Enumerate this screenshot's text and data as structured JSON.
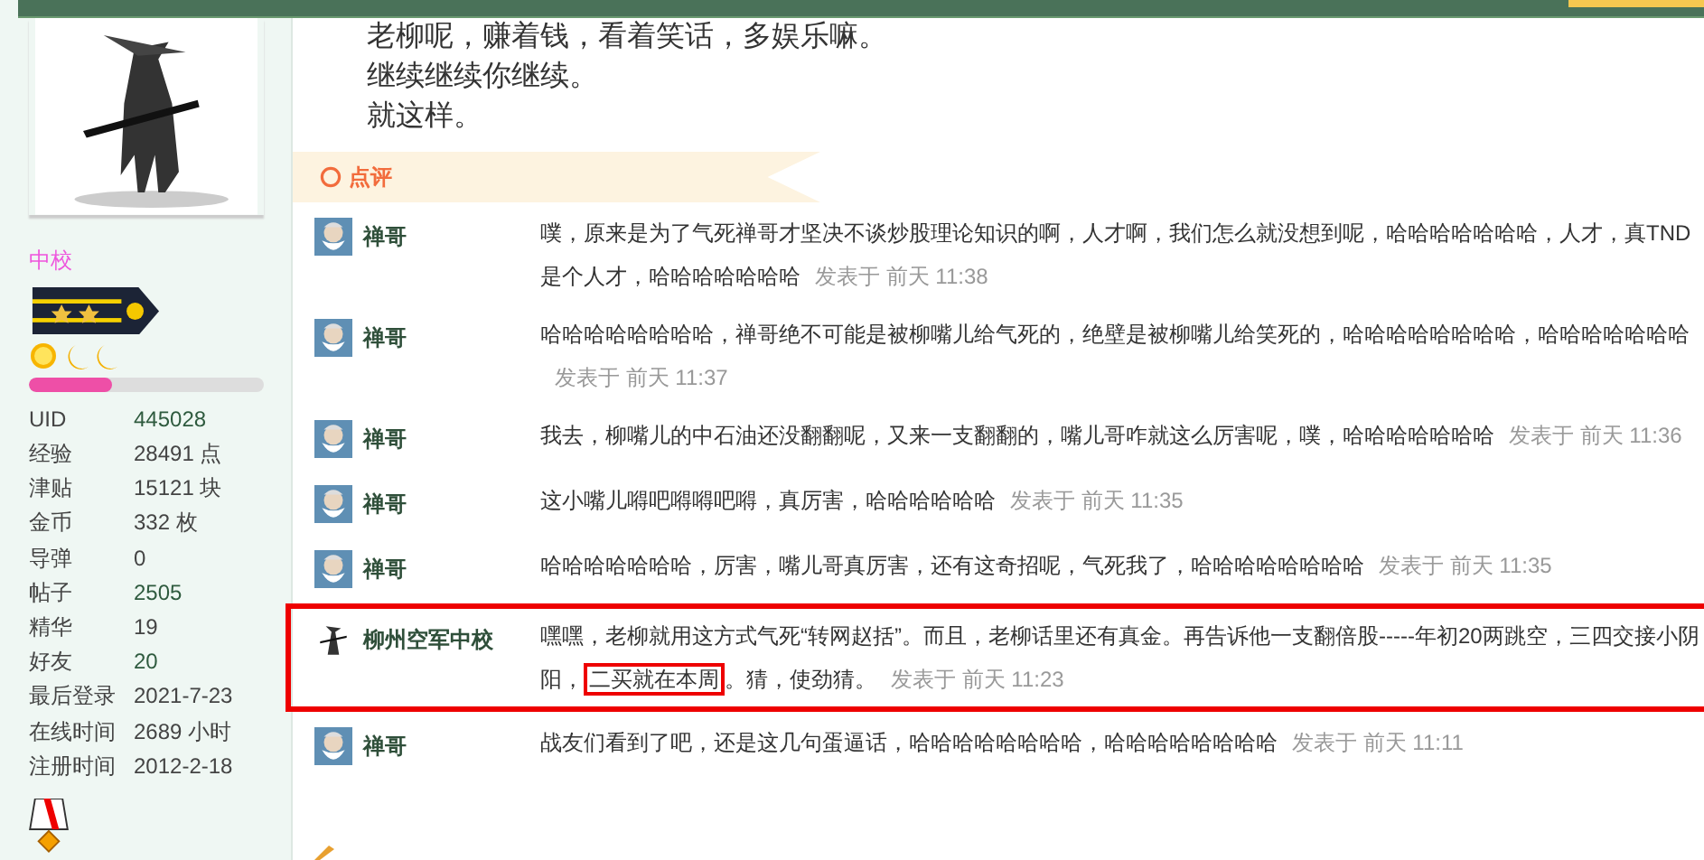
{
  "post_lines": [
    "老柳呢，赚着钱，看着笑话，多娱乐嘛。",
    "继续继续你继续。",
    "就这样。"
  ],
  "profile": {
    "rank": "中校",
    "level": 0.35,
    "stats": [
      {
        "label": "UID",
        "value": "445028",
        "link": true
      },
      {
        "label": "经验",
        "value": "28491 点",
        "link": false
      },
      {
        "label": "津贴",
        "value": "15121 块",
        "link": false
      },
      {
        "label": "金币",
        "value": "332 枚",
        "link": false
      },
      {
        "label": "导弹",
        "value": "0",
        "link": false
      },
      {
        "label": "帖子",
        "value": "2505",
        "link": true
      },
      {
        "label": "精华",
        "value": "19",
        "link": false
      },
      {
        "label": "好友",
        "value": "20",
        "link": true
      },
      {
        "label": "最后登录",
        "value": "2021-7-23",
        "link": false
      },
      {
        "label": "在线时间",
        "value": "2689 小时",
        "link": false
      },
      {
        "label": "注册时间",
        "value": "2012-2-18",
        "link": false
      }
    ]
  },
  "comments_header": "点评",
  "comments": [
    {
      "author": "禅哥",
      "kind": "elder",
      "highlighted": false,
      "segments": [
        {
          "text": "噗，原来是为了气死禅哥才坚决不谈炒股理论知识的啊，人才啊，我们怎么就没想到呢，哈哈哈哈哈哈哈，人才，真TND是个人才，哈哈哈哈哈哈哈",
          "boxed": false
        }
      ],
      "time": "发表于 前天 11:38"
    },
    {
      "author": "禅哥",
      "kind": "elder",
      "highlighted": false,
      "segments": [
        {
          "text": "哈哈哈哈哈哈哈哈，禅哥绝不可能是被柳嘴儿给气死的，绝壁是被柳嘴儿给笑死的，哈哈哈哈哈哈哈哈，哈哈哈哈哈哈哈",
          "boxed": false
        }
      ],
      "time": "发表于 前天 11:37"
    },
    {
      "author": "禅哥",
      "kind": "elder",
      "highlighted": false,
      "segments": [
        {
          "text": "我去，柳嘴儿的中石油还没翻翻呢，又来一支翻翻的，嘴儿哥咋就这么厉害呢，噗，哈哈哈哈哈哈哈",
          "boxed": false
        }
      ],
      "time": "发表于 前天 11:36"
    },
    {
      "author": "禅哥",
      "kind": "elder",
      "highlighted": false,
      "segments": [
        {
          "text": "这小嘴儿嘚吧嘚嘚吧嘚，真厉害，哈哈哈哈哈哈",
          "boxed": false
        }
      ],
      "time": "发表于 前天 11:35"
    },
    {
      "author": "禅哥",
      "kind": "elder",
      "highlighted": false,
      "segments": [
        {
          "text": "哈哈哈哈哈哈哈，厉害，嘴儿哥真厉害，还有这奇招呢，气死我了，哈哈哈哈哈哈哈哈",
          "boxed": false
        }
      ],
      "time": "发表于 前天 11:35"
    },
    {
      "author": "柳州空军中校",
      "kind": "swordsman",
      "highlighted": true,
      "segments": [
        {
          "text": "嘿嘿，老柳就用这方式气死“转网赵括”。而且，老柳话里还有真金。再告诉他一支翻倍股-----年初20两跳空，三四交接小阴阳，",
          "boxed": false
        },
        {
          "text": "二买就在本周",
          "boxed": true
        },
        {
          "text": "。猜，使劲猜。",
          "boxed": false
        }
      ],
      "time": "发表于 前天 11:23"
    },
    {
      "author": "禅哥",
      "kind": "elder",
      "highlighted": false,
      "segments": [
        {
          "text": "战友们看到了吧，还是这几句蛋逼话，哈哈哈哈哈哈哈哈，哈哈哈哈哈哈哈哈",
          "boxed": false
        }
      ],
      "time": "发表于 前天 11:11"
    }
  ]
}
